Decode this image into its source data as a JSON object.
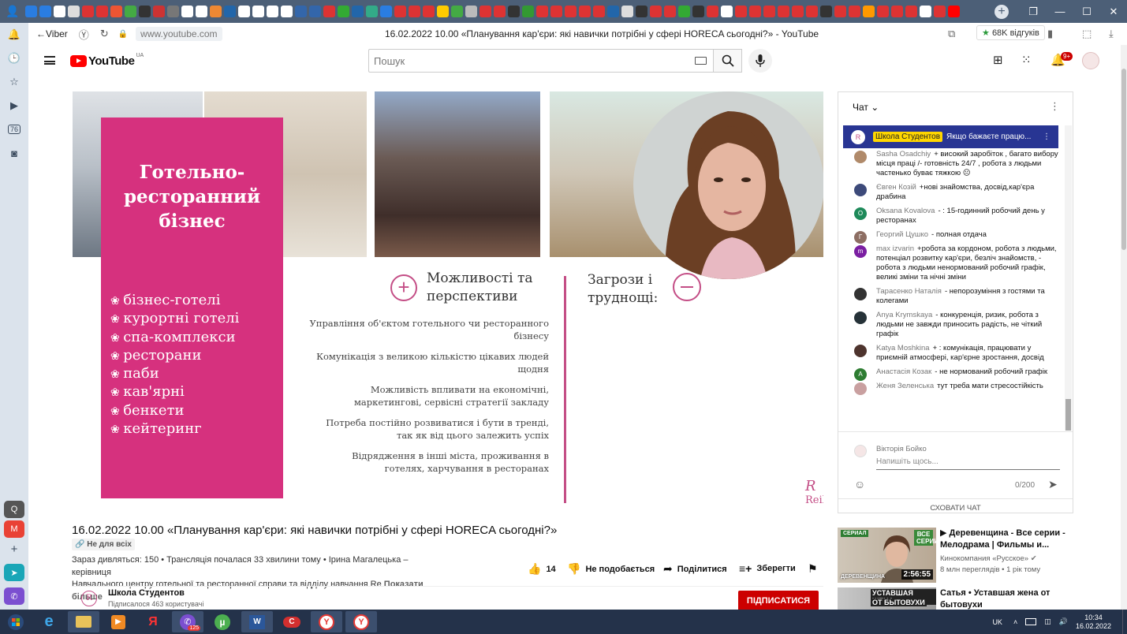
{
  "browser": {
    "back_label": "Viber",
    "url": "www.youtube.com",
    "page_title": "16.02.2022 10.00 «Планування кар'єри: які навички потрібні у сфері HORECA сьогодні?» - YouTube",
    "reviews": "68K відгуків",
    "sidebar_badge_1": "76",
    "tray_lang": "UK",
    "tray_time": "10:34",
    "tray_date": "16.02.2022",
    "taskbar_badge": "125"
  },
  "youtube": {
    "logo_text": "YouTube",
    "logo_region": "UA",
    "search_placeholder": "Пошук",
    "notif_badge": "9+"
  },
  "slide": {
    "pink_heading": "Готельно-\nресторанний\nбізнес",
    "pink_items": [
      "бізнес-готелі",
      "курортні готелі",
      "спа-комплекси",
      "ресторани",
      "паби",
      "кав'ярні",
      "бенкети",
      "кейтеринг"
    ],
    "opp_heading": "Можливості та\nперспективи",
    "thr_heading": "Загрози і\nтруднощі:",
    "opp_list": [
      "Управління об'єктом готельного чи ресторанного бізнесу",
      "Комунікація з великою кількістю цікавих людей щодня",
      "Можливість впливати на економічні, маркетингові, сервісні стратегії закладу",
      "Потреба постійно розвиватися і бути в тренді, так як від цього залежить успіх",
      "Відрядження в інші міста, проживання в готелях, харчування в ресторанах"
    ],
    "brand_mark": "R",
    "brand_text": "Reika"
  },
  "video": {
    "title": "16.02.2022 10.00 «Планування кар'єри: які навички потрібні у сфері HORECA сьогодні?»",
    "visibility": "Не для всіх",
    "meta_line1": "Зараз дивляться: 150 • Трансляція почалася 33 хвилини тому • Ірина Магалецька – керівниця",
    "meta_line2": "Навчального центру готельної та ресторанної справи та відділу навчання Re",
    "show_more": "Показати більше",
    "likes": "14",
    "dislike": "Не подобається",
    "share": "Поділитися",
    "save": "Зберегти",
    "channel_name": "Школа Студентов",
    "channel_subs": "Підписалося 463 користувачі",
    "subscribe": "ПІДПИСАТИСЯ"
  },
  "chat": {
    "header": "Чат",
    "pinned_author": "Школа Студентов",
    "pinned_text": "Якщо бажаєте працю...",
    "messages": [
      {
        "author": "Sasha Osadchiy",
        "text": "+ високий заробіток , багато вибору місця праці /- готовність 24/7 , робота з людьми частенько буває тяжкою 😐",
        "color": "#b08a6a",
        "initial": ""
      },
      {
        "author": "Євген Козій",
        "text": "+нові знайомства, досвід,кар'єра драбина",
        "color": "#3d4a7a",
        "initial": ""
      },
      {
        "author": "Oksana Kovalova",
        "text": "- : 15-годинний робочий день у ресторанах",
        "color": "#1e8a5a",
        "initial": "O"
      },
      {
        "author": "Георгий Цушко",
        "text": "- полная отдача",
        "color": "#8d6e63",
        "initial": "Г"
      },
      {
        "author": "max izvarin",
        "text": "+робота за кордоном, робота з людьми, потенціал розвитку кар'єри, безліч знайомств, - робота з людьми ненормований робочий графік, великі зміни та нічні зміни",
        "color": "#7b1fa2",
        "initial": "m"
      },
      {
        "author": "Тарасенко Наталія",
        "text": "- непорозуміння з гостями та колегами",
        "color": "#333",
        "initial": ""
      },
      {
        "author": "Anya Krymskaya",
        "text": "- конкуренція, ризик, робота з людьми не завжди приносить радість, не чіткий графік",
        "color": "#263238",
        "initial": ""
      },
      {
        "author": "Katya Moshkina",
        "text": "+ : комунікація, працювати у приємній атмосфері, кар'єрне зростання, досвід",
        "color": "#4e342e",
        "initial": ""
      },
      {
        "author": "Анастасія Козак",
        "text": "- не нормований робочий графік",
        "color": "#2e7d32",
        "initial": "А"
      },
      {
        "author": "Женя Зеленська",
        "text": "тут треба мати стресостійкість",
        "color": "#c9a0a0",
        "initial": ""
      }
    ],
    "input_user": "Вікторія Бойко",
    "input_placeholder": "Напишіть щось...",
    "char_count": "0/200",
    "hide_chat": "СХОВАТИ ЧАТ"
  },
  "recommendations": [
    {
      "title": "▶ Деревенщина - Все серии - Мелодрама | Фильмы и...",
      "channel": "Кинокомпания «Русское»",
      "stats": "8 млн переглядів • 1 рік тому",
      "duration": "2:56:55",
      "thumb_tag1": "СЕРИАЛ",
      "thumb_tag2": "ВСЕ СЕРИИ",
      "thumb_name": "ДЕРЕВЕНЩИНА"
    },
    {
      "title": "Сатья • Уставшая жена от бытовухи",
      "thumb_tag1": "УСТАВШАЯ ЖЕНА",
      "thumb_tag2": "ОТ БЫТОВУХИ"
    }
  ]
}
